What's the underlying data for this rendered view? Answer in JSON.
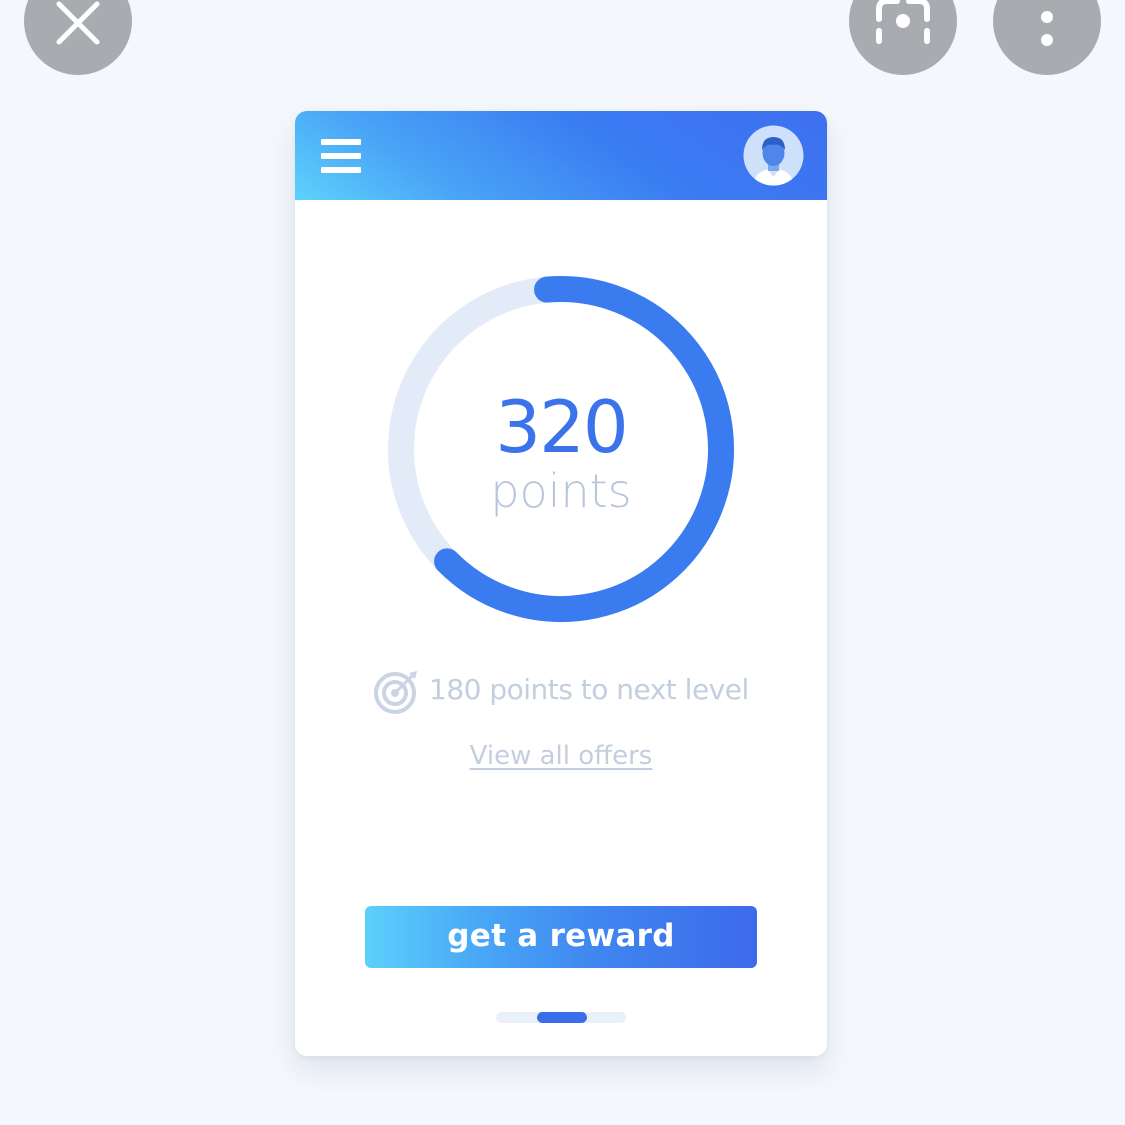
{
  "viewer": {
    "close_icon": "close-icon",
    "lens_icon": "lens-icon",
    "more_icon": "more-vertical-icon"
  },
  "header": {
    "menu_icon": "hamburger-menu-icon",
    "avatar_icon": "user-avatar-icon"
  },
  "points": {
    "value": "320",
    "unit": "points",
    "progress_fraction": 0.64
  },
  "level": {
    "icon": "target-icon",
    "text": "180 points to next level"
  },
  "links": {
    "view_offers": "View all offers"
  },
  "actions": {
    "reward_label": "get a reward"
  },
  "pager": {
    "active_index": 1
  },
  "colors": {
    "accent": "#3a73ea",
    "track": "#e3ebf9",
    "muted_text": "#c3cedf",
    "header_start": "#5dd2fb",
    "header_end": "#3e6ff0"
  }
}
